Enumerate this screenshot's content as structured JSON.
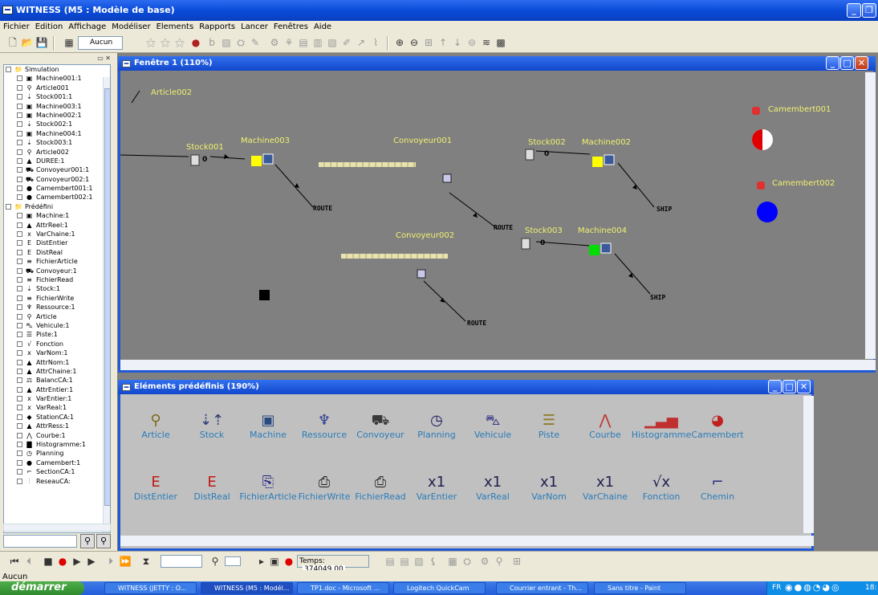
{
  "window": {
    "title": "WITNESS (M5 : Modèle de base)"
  },
  "menu": [
    "Fichier",
    "Edition",
    "Affichage",
    "Modéliser",
    "Elements",
    "Rapports",
    "Lancer",
    "Fenêtres",
    "Aide"
  ],
  "toolbar": {
    "element_select": "Aucun"
  },
  "tree": {
    "items": [
      {
        "label": "Simulation",
        "indent": 0,
        "icon": "folder-icon"
      },
      {
        "label": "Machine001:1",
        "indent": 1,
        "icon": "machine-icon"
      },
      {
        "label": "Article001",
        "indent": 1,
        "icon": "article-icon"
      },
      {
        "label": "Stock001:1",
        "indent": 1,
        "icon": "stock-icon"
      },
      {
        "label": "Machine003:1",
        "indent": 1,
        "icon": "machine-icon"
      },
      {
        "label": "Machine002:1",
        "indent": 1,
        "icon": "machine-icon"
      },
      {
        "label": "Stock002:1",
        "indent": 1,
        "icon": "stock-icon"
      },
      {
        "label": "Machine004:1",
        "indent": 1,
        "icon": "machine-icon"
      },
      {
        "label": "Stock003:1",
        "indent": 1,
        "icon": "stock-icon"
      },
      {
        "label": "Article002",
        "indent": 1,
        "icon": "article-icon"
      },
      {
        "label": "DUREE:1",
        "indent": 1,
        "icon": "attribute-icon"
      },
      {
        "label": "Convoyeur001:1",
        "indent": 1,
        "icon": "conveyor-icon"
      },
      {
        "label": "Convoyeur002:1",
        "indent": 1,
        "icon": "conveyor-icon"
      },
      {
        "label": "Camembert001:1",
        "indent": 1,
        "icon": "camembert-icon"
      },
      {
        "label": "Camembert002:1",
        "indent": 1,
        "icon": "camembert-icon"
      },
      {
        "label": "Prédéfini",
        "indent": 0,
        "icon": "folder-icon"
      },
      {
        "label": "Machine:1",
        "indent": 1,
        "icon": "machine-icon"
      },
      {
        "label": "AttrReel:1",
        "indent": 1,
        "icon": "attribute-icon"
      },
      {
        "label": "VarChaine:1",
        "indent": 1,
        "icon": "variable-icon"
      },
      {
        "label": "DistEntier",
        "indent": 1,
        "icon": "distribution-icon"
      },
      {
        "label": "DistReal",
        "indent": 1,
        "icon": "distribution-icon"
      },
      {
        "label": "FichierArticle",
        "indent": 1,
        "icon": "file-icon"
      },
      {
        "label": "Convoyeur:1",
        "indent": 1,
        "icon": "conveyor-icon"
      },
      {
        "label": "FichierRead",
        "indent": 1,
        "icon": "file-icon"
      },
      {
        "label": "Stock:1",
        "indent": 1,
        "icon": "stock-icon"
      },
      {
        "label": "FichierWrite",
        "indent": 1,
        "icon": "file-icon"
      },
      {
        "label": "Ressource:1",
        "indent": 1,
        "icon": "resource-icon"
      },
      {
        "label": "Article",
        "indent": 1,
        "icon": "article-icon"
      },
      {
        "label": "Vehicule:1",
        "indent": 1,
        "icon": "vehicle-icon"
      },
      {
        "label": "Piste:1",
        "indent": 1,
        "icon": "track-icon"
      },
      {
        "label": "Fonction",
        "indent": 1,
        "icon": "function-icon"
      },
      {
        "label": "VarNom:1",
        "indent": 1,
        "icon": "variable-icon"
      },
      {
        "label": "AttrNom:1",
        "indent": 1,
        "icon": "attribute-icon"
      },
      {
        "label": "AttrChaine:1",
        "indent": 1,
        "icon": "attribute-icon"
      },
      {
        "label": "BalancCA:1",
        "indent": 1,
        "icon": "balance-icon"
      },
      {
        "label": "AttrEntier:1",
        "indent": 1,
        "icon": "attribute-icon"
      },
      {
        "label": "VarEntier:1",
        "indent": 1,
        "icon": "variable-icon"
      },
      {
        "label": "VarReal:1",
        "indent": 1,
        "icon": "variable-icon"
      },
      {
        "label": "StationCA:1",
        "indent": 1,
        "icon": "station-icon"
      },
      {
        "label": "AttrRess:1",
        "indent": 1,
        "icon": "attribute-icon"
      },
      {
        "label": "Courbe:1",
        "indent": 1,
        "icon": "curve-icon"
      },
      {
        "label": "Histogramme:1",
        "indent": 1,
        "icon": "histogram-icon"
      },
      {
        "label": "Planning",
        "indent": 1,
        "icon": "planning-icon"
      },
      {
        "label": "Camembert:1",
        "indent": 1,
        "icon": "camembert-icon"
      },
      {
        "label": "SectionCA:1",
        "indent": 1,
        "icon": "section-icon"
      },
      {
        "label": "ReseauCA:",
        "indent": 1,
        "icon": "network-icon"
      }
    ]
  },
  "window1": {
    "title": "Fenêtre 1 (110%)",
    "labels": {
      "article002": "Article002",
      "stock001": "Stock001",
      "machine003": "Machine003",
      "convoyeur001": "Convoyeur001",
      "stock002": "Stock002",
      "machine002": "Machine002",
      "camembert001": "Camembert001",
      "camembert002": "Camembert002",
      "convoyeur002": "Convoyeur002",
      "stock003": "Stock003",
      "machine004": "Machine004",
      "route": "ROUTE",
      "ship": "SHIP",
      "stock_count": "0"
    }
  },
  "window2": {
    "title": "Eléments prédéfinis (190%)",
    "row1": [
      {
        "label": "Article",
        "glyph": "⚲",
        "color": "#7a6a1a"
      },
      {
        "label": "Stock",
        "glyph": "⇣⇡",
        "color": "#2a3a70"
      },
      {
        "label": "Machine",
        "glyph": "▣",
        "color": "#2a4a80"
      },
      {
        "label": "Ressource",
        "glyph": "♆",
        "color": "#2a3a90"
      },
      {
        "label": "Convoyeur",
        "glyph": "⛟",
        "color": "#3a3a3a"
      },
      {
        "label": "Planning",
        "glyph": "◷",
        "color": "#1a1a60"
      },
      {
        "label": "Vehicule",
        "glyph": "⛍",
        "color": "#2a2a80"
      },
      {
        "label": "Piste",
        "glyph": "☰",
        "color": "#8a7a20"
      },
      {
        "label": "Courbe",
        "glyph": "⋀",
        "color": "#c03030"
      },
      {
        "label": "Histogramme",
        "glyph": "▁▃▅",
        "color": "#c03030"
      },
      {
        "label": "Camembert",
        "glyph": "◕",
        "color": "#c02020"
      }
    ],
    "row2": [
      {
        "label": "DistEntier",
        "glyph": "E",
        "color": "#c01818"
      },
      {
        "label": "DistReal",
        "glyph": "E",
        "color": "#c01818"
      },
      {
        "label": "FichierArticle",
        "glyph": "⎘",
        "color": "#202080"
      },
      {
        "label": "FichierWrite",
        "glyph": "⎙",
        "color": "#202020"
      },
      {
        "label": "FichierRead",
        "glyph": "⎙",
        "color": "#202020"
      },
      {
        "label": "VarEntier",
        "glyph": "x1",
        "color": "#202050"
      },
      {
        "label": "VarReal",
        "glyph": "x1",
        "color": "#202050"
      },
      {
        "label": "VarNom",
        "glyph": "x1",
        "color": "#202050"
      },
      {
        "label": "VarChaine",
        "glyph": "x1",
        "color": "#202050"
      },
      {
        "label": "Fonction",
        "glyph": "√x",
        "color": "#202050"
      },
      {
        "label": "Chemin",
        "glyph": "⌐",
        "color": "#2a2a80"
      }
    ]
  },
  "runbar": {
    "time_label": "Temps:",
    "time_value": "374049.00"
  },
  "statusbar": {
    "text": "Aucun"
  },
  "taskbar": {
    "start": "démarrer",
    "tasks": [
      "WITNESS (JETTY : O...",
      "WITNESS (M5 : Modél...",
      "TP1.doc - Microsoft ...",
      "Logitech QuickCam",
      "Courrier entrant - Th...",
      "Sans titre - Paint"
    ],
    "lang": "FR",
    "clock": "18:"
  }
}
